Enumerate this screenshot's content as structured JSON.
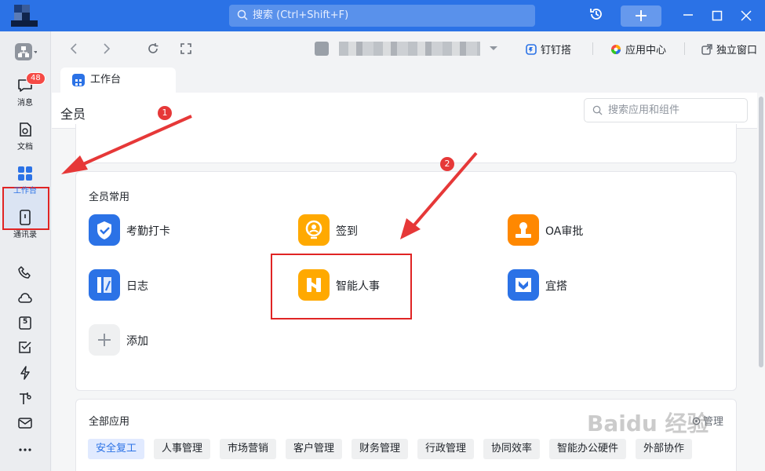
{
  "titlebar": {
    "search_placeholder": "搜索 (Ctrl+Shift+F)",
    "accent": "#2b72e6"
  },
  "rail": {
    "items": [
      {
        "label": "消息",
        "icon": "chat-icon",
        "badge": "48"
      },
      {
        "label": "文档",
        "icon": "doc-icon"
      },
      {
        "label": "工作台",
        "icon": "grid-icon"
      },
      {
        "label": "通讯录",
        "icon": "contacts-icon"
      }
    ],
    "extra_icons": [
      "phone-icon",
      "cloud-icon",
      "calendar-icon",
      "checkbox-icon",
      "lightning-icon",
      "hammer-icon",
      "mail-icon",
      "more-icon"
    ],
    "calendar_day": "5"
  },
  "nav": {
    "links": [
      "钉钉搭",
      "应用中心",
      "独立窗口"
    ]
  },
  "tab": {
    "label": "工作台"
  },
  "header": {
    "title": "全员",
    "search_placeholder": "搜索应用和组件"
  },
  "common": {
    "title": "全员常用",
    "apps": [
      {
        "label": "考勤打卡",
        "color": "#2b72e6"
      },
      {
        "label": "签到",
        "color": "#ffa900"
      },
      {
        "label": "OA审批",
        "color": "#ff8800"
      },
      {
        "label": "日志",
        "color": "#2b72e6"
      },
      {
        "label": "智能人事",
        "color": "#ffa900"
      },
      {
        "label": "宜搭",
        "color": "#2b72e6"
      },
      {
        "label": "添加",
        "color": "#eff0f1"
      }
    ]
  },
  "all": {
    "title": "全部应用",
    "manage_label": "管理",
    "chips": [
      "安全复工",
      "人事管理",
      "市场营销",
      "客户管理",
      "财务管理",
      "行政管理",
      "协同效率",
      "智能办公硬件",
      "外部协作"
    ]
  },
  "annotations": {
    "step1": "1",
    "step2": "2"
  },
  "watermark": "Baidu 经验"
}
